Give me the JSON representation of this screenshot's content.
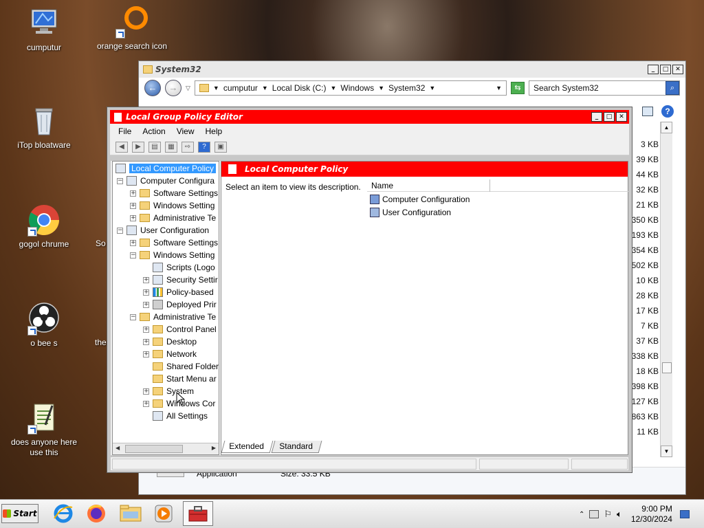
{
  "desktop": {
    "icons": [
      {
        "id": "computer",
        "label": "cumputur"
      },
      {
        "id": "orange",
        "label": "orange search icon"
      },
      {
        "id": "itop",
        "label": "iTop bloatware"
      },
      {
        "id": "chrome",
        "label": "gogol chrume"
      },
      {
        "id": "obs",
        "label": "o bee s"
      },
      {
        "id": "notepad",
        "label": "does anyone here use this"
      }
    ],
    "partial_labels": [
      "So",
      "the"
    ]
  },
  "explorer": {
    "title": "System32",
    "breadcrumb": [
      "cumputur",
      "Local Disk (C:)",
      "Windows",
      "System32"
    ],
    "search_placeholder": "Search System32",
    "sizes": [
      "3 KB",
      "39 KB",
      "44 KB",
      "32 KB",
      "21 KB",
      "350 KB",
      "193 KB",
      "354 KB",
      "502 KB",
      "10 KB",
      "28 KB",
      "17 KB",
      "7 KB",
      "37 KB",
      "338 KB",
      "18 KB",
      "398 KB",
      "127 KB",
      "863 KB",
      "11 KB"
    ],
    "selected_type": "Application",
    "selected_size": "Size: 33.5 KB"
  },
  "gpedit": {
    "title": "Local Group Policy Editor",
    "menu": [
      "File",
      "Action",
      "View",
      "Help"
    ],
    "panel_title": "Local Computer Policy",
    "description": "Select an item to view its description.",
    "column_name": "Name",
    "items": [
      "Computer Configuration",
      "User Configuration"
    ],
    "tabs": [
      "Extended",
      "Standard"
    ],
    "tree": [
      {
        "label": "Local Computer Policy"
      },
      {
        "label": "Computer Configura"
      },
      {
        "label": "Software Settings"
      },
      {
        "label": "Windows Setting"
      },
      {
        "label": "Administrative Te"
      },
      {
        "label": "User Configuration"
      },
      {
        "label": "Software Settings"
      },
      {
        "label": "Windows Setting"
      },
      {
        "label": "Scripts (Logo"
      },
      {
        "label": "Security Settir"
      },
      {
        "label": "Policy-based"
      },
      {
        "label": "Deployed Prir"
      },
      {
        "label": "Administrative Te"
      },
      {
        "label": "Control Panel"
      },
      {
        "label": "Desktop"
      },
      {
        "label": "Network"
      },
      {
        "label": "Shared Folder"
      },
      {
        "label": "Start Menu ar"
      },
      {
        "label": "System"
      },
      {
        "label": "Windows Cor"
      },
      {
        "label": "All Settings"
      }
    ]
  },
  "taskbar": {
    "start_label": "Start",
    "apps": [
      "internet-explorer",
      "firefox",
      "file-explorer",
      "media-player",
      "toolbox"
    ],
    "time": "9:00 PM",
    "date": "12/30/2024"
  },
  "colors": {
    "gp_titlebar": "#ff0000",
    "selection": "#3399ff"
  }
}
